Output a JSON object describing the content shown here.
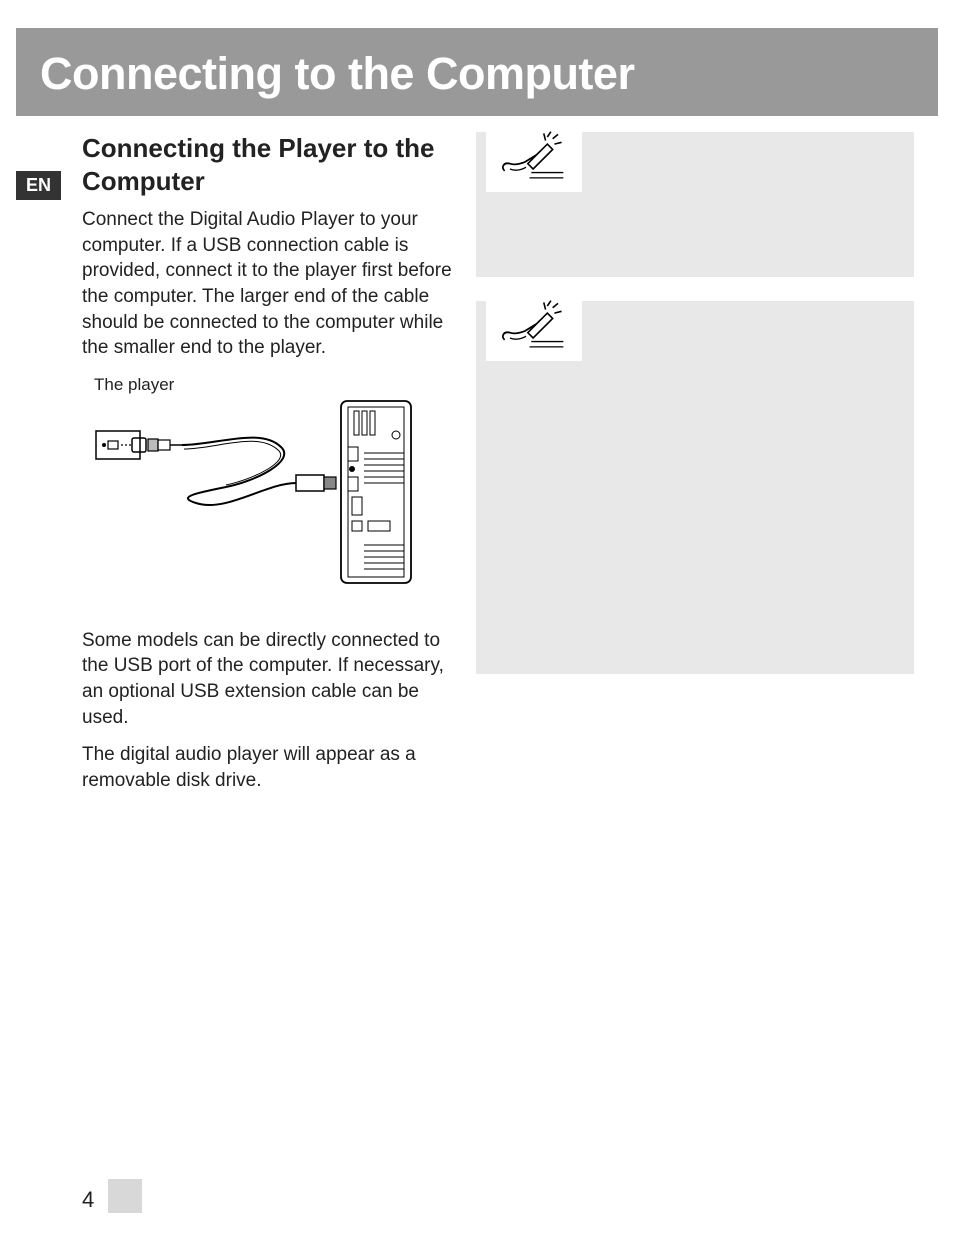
{
  "header": {
    "title": "Connecting to the Computer"
  },
  "language_tag": "EN",
  "left": {
    "heading": "Connecting the Player to the Computer",
    "paragraph1": "Connect the Digital Audio Player to your computer. If a USB connection cable is provided, connect it to the player first before the computer. The larger end of the cable should be connected to the computer while the smaller end to the player.",
    "diagram_label": "The player",
    "paragraph2": "Some models can be directly connected to the USB port of the computer. If necessary, an optional USB extension cable can be used.",
    "paragraph3": "The digital audio player will appear as a removable disk drive."
  },
  "footer": {
    "page_number": "4"
  }
}
